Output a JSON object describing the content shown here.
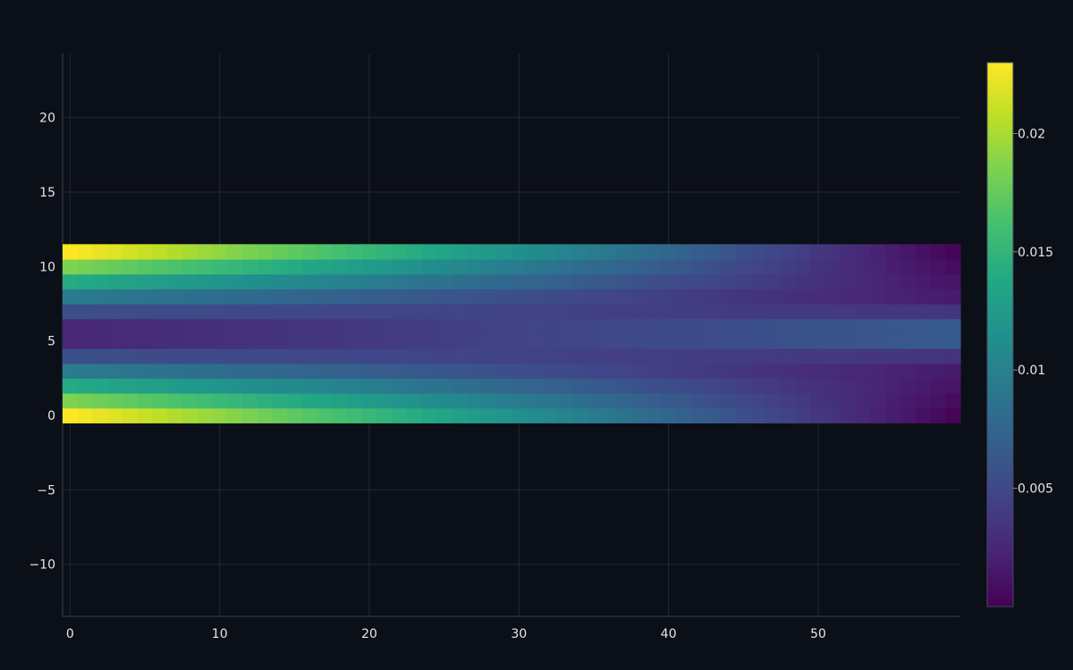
{
  "chart_data": {
    "type": "heatmap",
    "title": "",
    "xlabel": "",
    "ylabel": "",
    "x_range": [
      -0.5,
      59.5
    ],
    "y_range": [
      -0.5,
      11.5
    ],
    "xlim": [
      -0.5,
      59.5
    ],
    "ylim": [
      -13.5,
      24.3
    ],
    "x_ticks": [
      0,
      10,
      20,
      30,
      40,
      50
    ],
    "x_tick_labels": [
      "0",
      "10",
      "20",
      "30",
      "40",
      "50"
    ],
    "y_ticks": [
      -10,
      -5,
      0,
      5,
      10,
      15,
      20
    ],
    "y_tick_labels": [
      "−10",
      "−5",
      "0",
      "5",
      "10",
      "15",
      "20"
    ],
    "colorscale": "viridis",
    "zmin": 0.0,
    "zmax": 0.023,
    "colorbar_ticks": [
      0.005,
      0.01,
      0.015,
      0.02
    ],
    "colorbar_tick_labels": [
      "0.005",
      "0.01",
      "0.015",
      "0.02"
    ],
    "row_start_values": [
      0.023,
      0.0185,
      0.014,
      0.0095,
      0.0055,
      0.0025,
      0.0025,
      0.0055,
      0.0095,
      0.014,
      0.0185,
      0.023
    ],
    "row_end_values": [
      0.0003,
      0.0008,
      0.0013,
      0.0017,
      0.0035,
      0.0065,
      0.0065,
      0.0035,
      0.0017,
      0.0013,
      0.0008,
      0.0003
    ],
    "grid": true,
    "colorbar_position": "right"
  }
}
